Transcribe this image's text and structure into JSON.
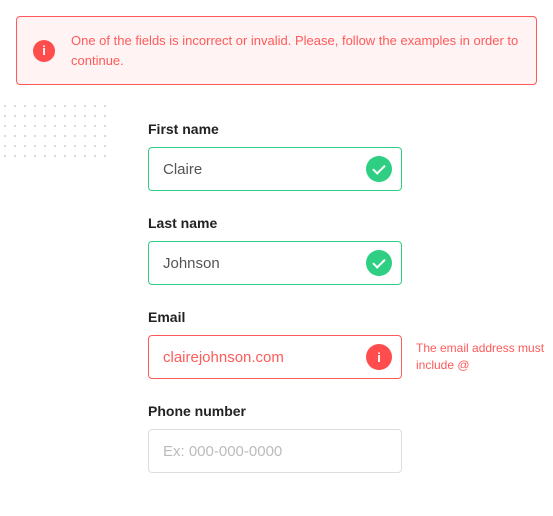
{
  "alert": {
    "message": "One of the fields is incorrect or invalid. Please, follow the examples in order to continue."
  },
  "fields": {
    "first_name": {
      "label": "First name",
      "value": "Claire"
    },
    "last_name": {
      "label": "Last name",
      "value": "Johnson"
    },
    "email": {
      "label": "Email",
      "value": "clairejohnson.com",
      "hint": "The email address must include @"
    },
    "phone": {
      "label": "Phone number",
      "placeholder": "Ex: 000-000-0000"
    }
  }
}
